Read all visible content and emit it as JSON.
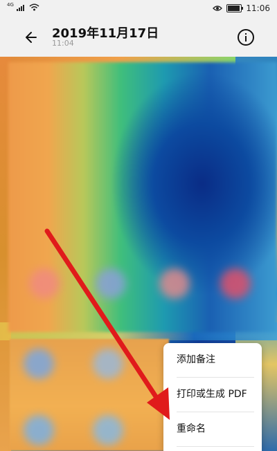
{
  "status_bar": {
    "network": "4G",
    "time": "11:06",
    "battery_level": 0.9,
    "icons": [
      "signal-icon",
      "wifi-icon",
      "eye-icon",
      "battery-icon"
    ]
  },
  "header": {
    "title": "2019年11月17日",
    "subtitle": "11:04",
    "back_icon": "back-arrow-icon",
    "info_icon": "info-icon"
  },
  "context_menu": {
    "items": [
      {
        "label": "添加备注"
      },
      {
        "label": "打印或生成 PDF"
      },
      {
        "label": "重命名"
      }
    ]
  },
  "annotation": {
    "arrow_color": "#e01b1b"
  }
}
